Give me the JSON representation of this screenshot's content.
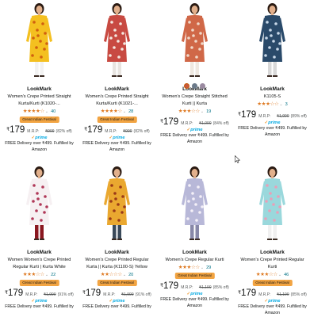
{
  "colors": {
    "star": "#de7921",
    "prime": "#00a8e1",
    "deal_badge": "#f2a442",
    "review_count": "#007185"
  },
  "products": [
    {
      "brand": "LookMark",
      "title": "Women's Crepe Printed Straight\nKurta/Kurti (K1020-...",
      "stars": "★★★★☆",
      "rating_value": 4.0,
      "review_count": "40",
      "deal": "Great Indian Festival",
      "currency": "₹",
      "price": "179",
      "mrp_label": "M.R.P:",
      "mrp": "₹999",
      "discount": "(82% off)",
      "prime_label": "prime",
      "delivery": "FREE Delivery over ₹499. Fulfilled by\nAmazon",
      "image": {
        "bg": "#f4c020",
        "print": "#d06010",
        "leg": "#f2f2f2"
      }
    },
    {
      "brand": "LookMark",
      "title": "Women's Crepe Printed Straight\nKurta/Kurti (K1021-...",
      "stars": "★★★★☆",
      "rating_value": 3.5,
      "review_count": "28",
      "deal": "Great Indian Festival",
      "currency": "₹",
      "price": "179",
      "mrp_label": "M.R.P:",
      "mrp": "₹999",
      "discount": "(82% off)",
      "prime_label": "prime",
      "delivery": "FREE Delivery over ₹499. Fulfilled by\nAmazon",
      "image": {
        "bg": "#c84a42",
        "print": "#f4e8e0",
        "leg": "#e8e4e0"
      }
    },
    {
      "brand": "LookMark",
      "title": "Women's Crepe Straight Stitched\nKurti || Kurta",
      "swatches": [
        "#c85a40",
        "#6c7a8a",
        "#9a8aa0"
      ],
      "stars": "★★★☆☆",
      "rating_value": 3.0,
      "review_count": "19",
      "currency": "₹",
      "price": "179",
      "mrp_label": "M.R.P:",
      "mrp": "₹1,099",
      "discount": "(84% off)",
      "prime_label": "prime",
      "delivery": "FREE Delivery over ₹499. Fulfilled by\nAmazon",
      "image": {
        "bg": "#d06848",
        "print": "#f0d8c8",
        "leg": "#efe8e0"
      }
    },
    {
      "brand": "LookMark",
      "title": "K1105-S",
      "stars": "★★★☆☆",
      "rating_value": 3.0,
      "review_count": "3",
      "currency": "₹",
      "price": "179",
      "mrp_label": "M.R.P:",
      "mrp": "₹1,999",
      "discount": "(89% off)",
      "prime_label": "prime",
      "delivery": "FREE Delivery over ₹499. Fulfilled by\nAmazon",
      "image": {
        "bg": "#2a4a6a",
        "print": "#c8d8e8",
        "leg": "#d8d8d8"
      }
    },
    {
      "brand": "LookMark",
      "title": "Women Women's Crepe Printed\nRegular Kurti | Kurta White",
      "stars": "★★★☆☆",
      "rating_value": 3.5,
      "review_count": "22",
      "deal": "Great Indian Festival",
      "currency": "₹",
      "price": "179",
      "mrp_label": "M.R.P:",
      "mrp": "₹1,999",
      "discount": "(91% off)",
      "prime_label": "prime",
      "delivery": "FREE Delivery over ₹499. Fulfilled by",
      "image": {
        "bg": "#f6f0f2",
        "print": "#b03858",
        "leg": "#8a1820"
      }
    },
    {
      "brand": "LookMark",
      "title": "Women's Crepe Printed Regular\nKurta || Kurta (K1100-S) Yellow",
      "stars": "★★☆☆☆",
      "rating_value": 2.5,
      "review_count": "20",
      "deal": "Great Indian Festival",
      "currency": "₹",
      "price": "179",
      "mrp_label": "M.R.P:",
      "mrp": "₹1,999",
      "discount": "(91% off)",
      "prime_label": "prime",
      "delivery": "FREE Delivery over ₹499. Fulfilled by",
      "image": {
        "bg": "#eaa830",
        "print": "#9a3a18",
        "leg": "#3a4a5a"
      }
    },
    {
      "brand": "LookMark",
      "title": "Women's Crepe Regular Kurti",
      "stars": "★★★☆☆",
      "rating_value": 3.5,
      "review_count": "29",
      "deal": "Great Indian Festival",
      "currency": "₹",
      "price": "179",
      "mrp_label": "M.R.P:",
      "mrp": "₹1,199",
      "discount": "(85% off)",
      "prime_label": "prime",
      "delivery": "FREE Delivery over ₹499. Fulfilled by\nAmazon",
      "image": {
        "bg": "#b8b8d8",
        "print": "#f4f0f8",
        "leg": "#8888a8"
      }
    },
    {
      "brand": "LookMark",
      "title": "Women's Crepe Printed Regular\nKurti",
      "stars": "★★★☆☆",
      "rating_value": 3.5,
      "review_count": "46",
      "deal": "Great Indian Festival",
      "currency": "₹",
      "price": "179",
      "mrp_label": "M.R.P:",
      "mrp": "₹1,199",
      "discount": "(85% off)",
      "prime_label": "prime",
      "delivery": "FREE Delivery over ₹499. Fulfilled by\nAmazon",
      "image": {
        "bg": "#9ad8dc",
        "print": "#e8a0b8",
        "leg": "#f0f0f0"
      }
    }
  ]
}
